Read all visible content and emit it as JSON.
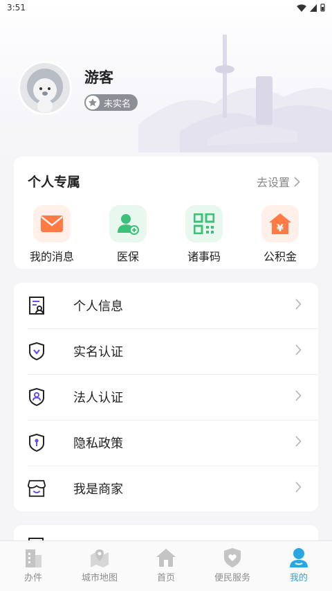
{
  "status_bar": {
    "time": "3:51"
  },
  "profile": {
    "name": "游客",
    "badge": "未实名"
  },
  "personal": {
    "title": "个人专属",
    "link": "去设置",
    "items": [
      {
        "label": "我的消息",
        "icon": "mail-icon",
        "bg": "#fff0ea",
        "color": "#ff7a45"
      },
      {
        "label": "医保",
        "icon": "medical-user-icon",
        "bg": "#e9f8ee",
        "color": "#3cc07a"
      },
      {
        "label": "诸事码",
        "icon": "qr-code-icon",
        "bg": "#e9f8ee",
        "color": "#3cc07a"
      },
      {
        "label": "公积金",
        "icon": "house-yuan-icon",
        "bg": "#fff0ea",
        "color": "#ff7a45"
      }
    ]
  },
  "menu": [
    {
      "label": "个人信息",
      "icon": "id-card-icon"
    },
    {
      "label": "实名认证",
      "icon": "shield-check-icon"
    },
    {
      "label": "法人认证",
      "icon": "shield-person-icon"
    },
    {
      "label": "隐私政策",
      "icon": "shield-lock-icon"
    },
    {
      "label": "我是商家",
      "icon": "shop-icon"
    }
  ],
  "tabs": [
    {
      "label": "办件",
      "icon": "building-icon",
      "active": false
    },
    {
      "label": "城市地图",
      "icon": "map-pin-icon",
      "active": false
    },
    {
      "label": "首页",
      "icon": "home-icon",
      "active": false
    },
    {
      "label": "便民服务",
      "icon": "shield-heart-icon",
      "active": false
    },
    {
      "label": "我的",
      "icon": "user-icon",
      "active": true
    }
  ],
  "colors": {
    "accent": "#2aa6e0",
    "purple": "#6c4ce8",
    "inactive_tab": "#c4c4c4"
  }
}
